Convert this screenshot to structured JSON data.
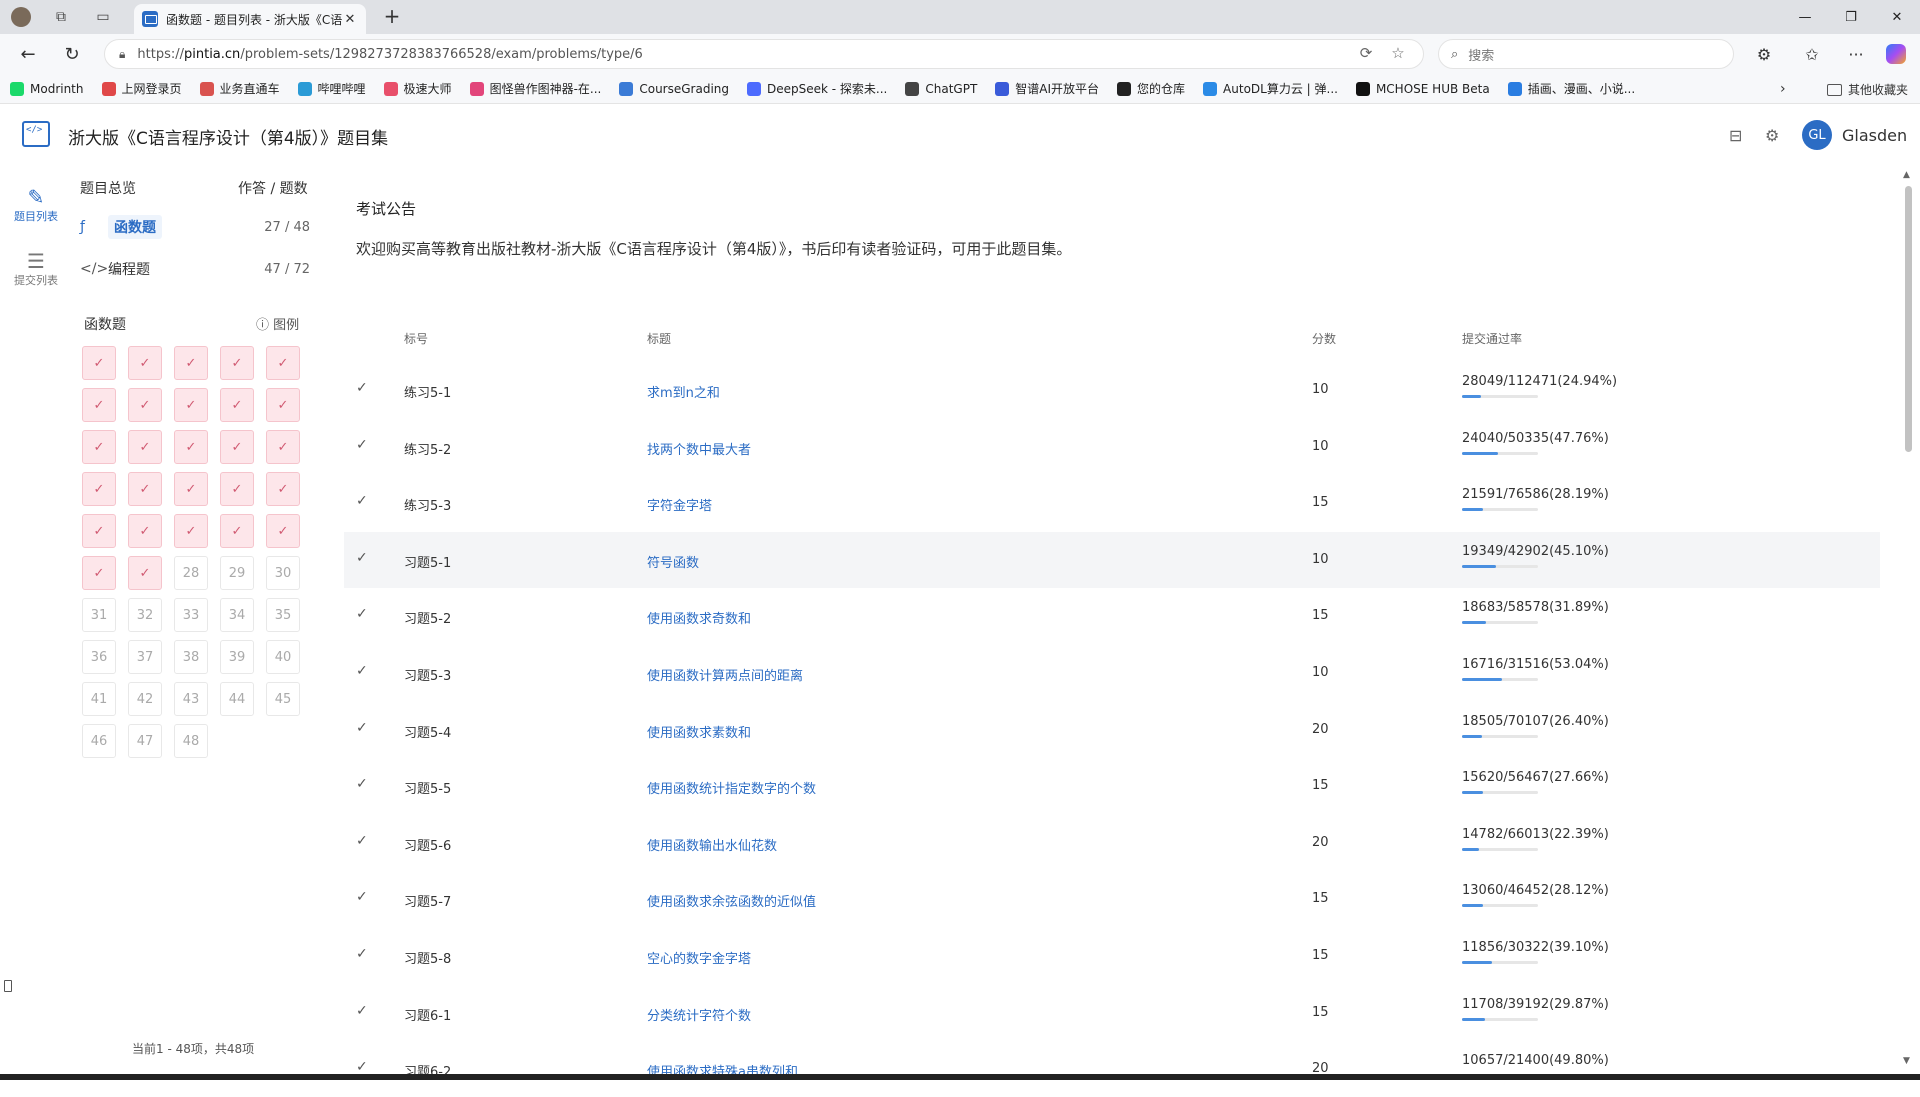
{
  "browser": {
    "tab_title": "函数题 - 题目列表 - 浙大版《C语",
    "url_prefix": "https://",
    "url_host": "pintia.cn",
    "url_path": "/problem-sets/1298273728383766528/exam/problems/type/6",
    "search_placeholder": "搜索",
    "bookmarks": [
      {
        "label": "Modrinth",
        "color": "#1bd96a"
      },
      {
        "label": "上网登录页",
        "color": "#e04848"
      },
      {
        "label": "业务直通车",
        "color": "#d9534f"
      },
      {
        "label": "哔哩哔哩",
        "color": "#2b9bd6"
      },
      {
        "label": "极速大师",
        "color": "#e84f6a"
      },
      {
        "label": "图怪兽作图神器-在...",
        "color": "#e2457a"
      },
      {
        "label": "CourseGrading",
        "color": "#3b7bd6"
      },
      {
        "label": "DeepSeek - 探索未...",
        "color": "#4d6bfe"
      },
      {
        "label": "ChatGPT",
        "color": "#444444"
      },
      {
        "label": "智谱AI开放平台",
        "color": "#3a5bd9"
      },
      {
        "label": "您的仓库",
        "color": "#222222"
      },
      {
        "label": "AutoDL算力云 | 弹...",
        "color": "#2b8be6"
      },
      {
        "label": "MCHOSE HUB Beta",
        "color": "#111111"
      },
      {
        "label": "插画、漫画、小说...",
        "color": "#2a7de1"
      }
    ],
    "other_bookmarks": "其他收藏夹"
  },
  "header": {
    "site_title": "浙大版《C语言程序设计（第4版）》题目集",
    "avatar_initials": "GL",
    "username": "Glasden"
  },
  "rail": {
    "problems": "题目列表",
    "submissions": "提交列表"
  },
  "sidebar": {
    "overview": "题目总览",
    "answered_total": "作答 / 题数",
    "types": [
      {
        "label": "函数题",
        "count": "27 / 48",
        "active": true
      },
      {
        "label": "编程题",
        "count": "47 / 72",
        "active": false
      }
    ],
    "grid_title": "函数题",
    "legend": "图例",
    "cells": [
      {
        "n": "1",
        "done": true
      },
      {
        "n": "2",
        "done": true
      },
      {
        "n": "3",
        "done": true
      },
      {
        "n": "4",
        "done": true
      },
      {
        "n": "5",
        "done": true
      },
      {
        "n": "6",
        "done": true
      },
      {
        "n": "7",
        "done": true
      },
      {
        "n": "8",
        "done": true
      },
      {
        "n": "9",
        "done": true
      },
      {
        "n": "10",
        "done": true
      },
      {
        "n": "11",
        "done": true
      },
      {
        "n": "12",
        "done": true
      },
      {
        "n": "13",
        "done": true
      },
      {
        "n": "14",
        "done": true
      },
      {
        "n": "15",
        "done": true
      },
      {
        "n": "16",
        "done": true
      },
      {
        "n": "17",
        "done": true
      },
      {
        "n": "18",
        "done": true
      },
      {
        "n": "19",
        "done": true
      },
      {
        "n": "20",
        "done": true
      },
      {
        "n": "21",
        "done": true
      },
      {
        "n": "22",
        "done": true
      },
      {
        "n": "23",
        "done": true
      },
      {
        "n": "24",
        "done": true
      },
      {
        "n": "25",
        "done": true
      },
      {
        "n": "26",
        "done": true
      },
      {
        "n": "27",
        "done": true
      },
      {
        "n": "28",
        "done": false
      },
      {
        "n": "29",
        "done": false
      },
      {
        "n": "30",
        "done": false
      },
      {
        "n": "31",
        "done": false
      },
      {
        "n": "32",
        "done": false
      },
      {
        "n": "33",
        "done": false
      },
      {
        "n": "34",
        "done": false
      },
      {
        "n": "35",
        "done": false
      },
      {
        "n": "36",
        "done": false
      },
      {
        "n": "37",
        "done": false
      },
      {
        "n": "38",
        "done": false
      },
      {
        "n": "39",
        "done": false
      },
      {
        "n": "40",
        "done": false
      },
      {
        "n": "41",
        "done": false
      },
      {
        "n": "42",
        "done": false
      },
      {
        "n": "43",
        "done": false
      },
      {
        "n": "44",
        "done": false
      },
      {
        "n": "45",
        "done": false
      },
      {
        "n": "46",
        "done": false
      },
      {
        "n": "47",
        "done": false
      },
      {
        "n": "48",
        "done": false
      }
    ],
    "pager_info": "当前1 - 48项，共48项"
  },
  "notice": {
    "title": "考试公告",
    "body": "欢迎购买高等教育出版社教材-浙大版《C语言程序设计（第4版）》，书后印有读者验证码，可用于此题目集。"
  },
  "table": {
    "headers": {
      "num": "标号",
      "title": "标题",
      "score": "分数",
      "rate": "提交通过率"
    },
    "rows": [
      {
        "num": "练习5-1",
        "title": "求m到n之和",
        "score": "10",
        "rate": "28049/112471(24.94%)",
        "pct": 24.94
      },
      {
        "num": "练习5-2",
        "title": "找两个数中最大者",
        "score": "10",
        "rate": "24040/50335(47.76%)",
        "pct": 47.76
      },
      {
        "num": "练习5-3",
        "title": "字符金字塔",
        "score": "15",
        "rate": "21591/76586(28.19%)",
        "pct": 28.19
      },
      {
        "num": "习题5-1",
        "title": "符号函数",
        "score": "10",
        "rate": "19349/42902(45.10%)",
        "pct": 45.1
      },
      {
        "num": "习题5-2",
        "title": "使用函数求奇数和",
        "score": "15",
        "rate": "18683/58578(31.89%)",
        "pct": 31.89
      },
      {
        "num": "习题5-3",
        "title": "使用函数计算两点间的距离",
        "score": "10",
        "rate": "16716/31516(53.04%)",
        "pct": 53.04
      },
      {
        "num": "习题5-4",
        "title": "使用函数求素数和",
        "score": "20",
        "rate": "18505/70107(26.40%)",
        "pct": 26.4
      },
      {
        "num": "习题5-5",
        "title": "使用函数统计指定数字的个数",
        "score": "15",
        "rate": "15620/56467(27.66%)",
        "pct": 27.66
      },
      {
        "num": "习题5-6",
        "title": "使用函数输出水仙花数",
        "score": "20",
        "rate": "14782/66013(22.39%)",
        "pct": 22.39
      },
      {
        "num": "习题5-7",
        "title": "使用函数求余弦函数的近似值",
        "score": "15",
        "rate": "13060/46452(28.12%)",
        "pct": 28.12
      },
      {
        "num": "习题5-8",
        "title": "空心的数字金字塔",
        "score": "15",
        "rate": "11856/30322(39.10%)",
        "pct": 39.1
      },
      {
        "num": "习题6-1",
        "title": "分类统计字符个数",
        "score": "15",
        "rate": "11708/39192(29.87%)",
        "pct": 29.87
      },
      {
        "num": "习题6-2",
        "title": "使用函数求特殊a串数列和",
        "score": "20",
        "rate": "10657/21400(49.80%)",
        "pct": 49.8
      }
    ]
  }
}
